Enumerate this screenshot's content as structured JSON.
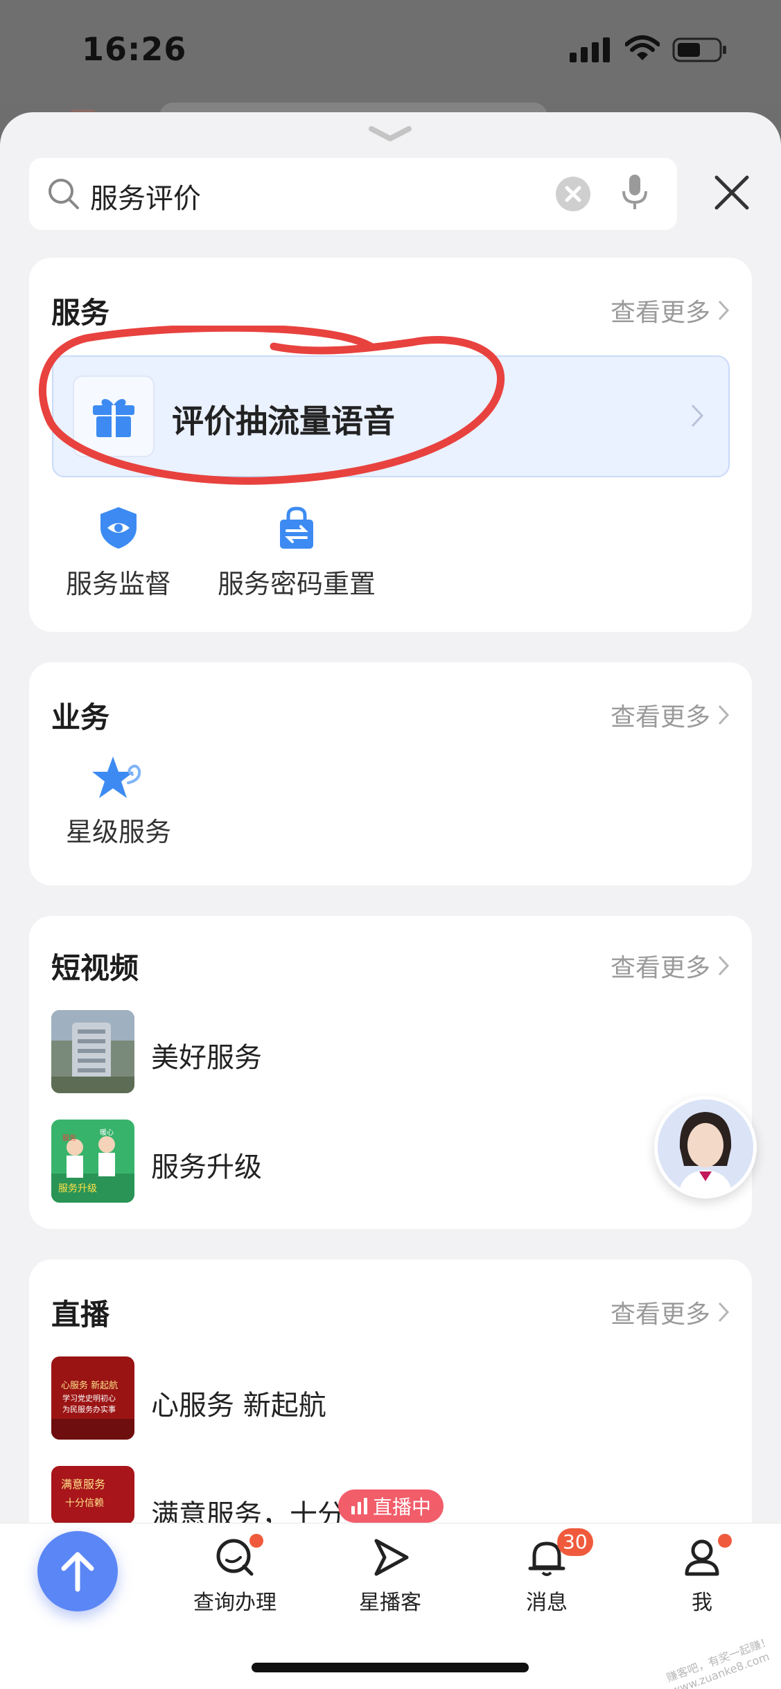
{
  "status_bar": {
    "time": "16:26"
  },
  "search": {
    "query": "服务评价"
  },
  "sections": {
    "service": {
      "title": "服务",
      "more": "查看更多",
      "highlight_label": "评价抽流量语音",
      "items": [
        {
          "label": "服务监督",
          "icon": "shield-eye-icon"
        },
        {
          "label": "服务密码重置",
          "icon": "lock-swap-icon"
        }
      ]
    },
    "business": {
      "title": "业务",
      "more": "查看更多",
      "items": [
        {
          "label": "星级服务",
          "icon": "star-swirl-icon"
        }
      ]
    },
    "short_video": {
      "title": "短视频",
      "more": "查看更多",
      "items": [
        {
          "label": "美好服务"
        },
        {
          "label": "服务升级"
        }
      ],
      "thumb_texts": [
        "服务",
        "暖心",
        "服务升级"
      ]
    },
    "live": {
      "title": "直播",
      "more": "查看更多",
      "items": [
        {
          "label": "心服务 新起航"
        },
        {
          "label": "满意服务，十分"
        }
      ],
      "thumb_texts": [
        "心服务 新起航",
        "学习党史明初心",
        "为民服务办实事",
        "满意服务",
        "十分信赖"
      ]
    }
  },
  "live_badge": "直播中",
  "tabbar": {
    "tabs": [
      {
        "label": "查询办理",
        "icon": "search-bubble-icon",
        "dot": true
      },
      {
        "label": "星播客",
        "icon": "play-arrow-icon",
        "dot": false
      },
      {
        "label": "消息",
        "icon": "bell-icon",
        "badge": "30"
      },
      {
        "label": "我",
        "icon": "person-icon",
        "dot": true
      }
    ]
  },
  "watermark": "赚客吧，有奖一起赚！ www.zuanke8.com",
  "colors": {
    "accent": "#3d8bf2",
    "fab": "#5b86f5",
    "badge": "#f05a3c",
    "annotation": "#e8423f"
  }
}
